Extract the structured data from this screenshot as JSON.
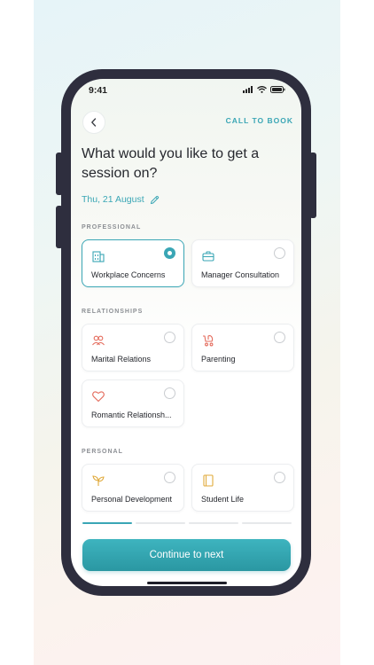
{
  "status_bar": {
    "time": "9:41"
  },
  "header": {
    "call_label": "CALL TO BOOK"
  },
  "title": "What would you like to get a session on?",
  "date": "Thu, 21 August",
  "sections": [
    {
      "label": "PROFESSIONAL",
      "cards": [
        {
          "label": "Workplace Concerns",
          "icon": "building-icon",
          "selected": true
        },
        {
          "label": "Manager Consultation",
          "icon": "briefcase-icon",
          "selected": false
        }
      ]
    },
    {
      "label": "RELATIONSHIPS",
      "cards": [
        {
          "label": "Marital Relations",
          "icon": "people-icon",
          "selected": false
        },
        {
          "label": "Parenting",
          "icon": "stroller-icon",
          "selected": false
        },
        {
          "label": "Romantic Relationsh...",
          "icon": "heart-icon",
          "selected": false
        }
      ]
    },
    {
      "label": "PERSONAL",
      "cards": [
        {
          "label": "Personal Development",
          "icon": "sprout-icon",
          "selected": false
        },
        {
          "label": "Student Life",
          "icon": "book-icon",
          "selected": false
        }
      ]
    }
  ],
  "progress": {
    "total_steps": 4,
    "current_step": 1
  },
  "continue_label": "Continue to next",
  "colors": {
    "accent": "#3aa6b5",
    "text": "#26282e",
    "coral": "#e46b5c",
    "amber": "#e0a93a"
  }
}
